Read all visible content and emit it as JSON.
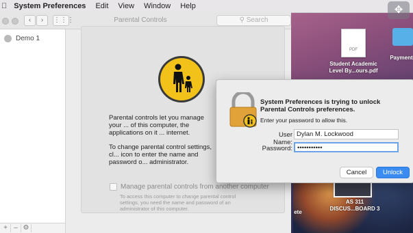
{
  "menubar": {
    "apple_icon": "apple-icon",
    "app_name": "System Preferences",
    "items": [
      "Edit",
      "View",
      "Window",
      "Help"
    ]
  },
  "window": {
    "title": "Parental Controls",
    "search_placeholder": "Search",
    "users": [
      {
        "name": "Demo 1"
      }
    ],
    "sidebar_buttons": [
      "+",
      "–",
      "⚙"
    ]
  },
  "panel": {
    "intro_text": "Parental controls let you manage your ... of this computer, the applications on it ... internet.",
    "change_text": "To change parental control settings, cl... icon to enter the name and password o... administrator.",
    "manage_checkbox_label": "Manage parental controls from another computer",
    "manage_note": "To access this computer to change parental control settings, you need the name and password of an administrator of this computer."
  },
  "desktop": {
    "files": [
      {
        "name": "Student Academic Level By...ours.pdf",
        "badge": "PDF"
      },
      {
        "name": "Payment"
      },
      {
        "name": "AS 311 DISCUS...BOARD 3"
      },
      {
        "name": "ete"
      }
    ]
  },
  "dialog": {
    "heading": "System Preferences is trying to unlock Parental Controls preferences.",
    "instructions": "Enter your password to allow this.",
    "username_label": "User Name:",
    "username_value": "Dylan M. Lockwood",
    "password_label": "Password:",
    "password_value": "•••••••••••",
    "cancel_label": "Cancel",
    "unlock_label": "Unlock"
  },
  "colors": {
    "accent": "#3b8cf0",
    "parental_icon_bg": "#f2c21a"
  }
}
